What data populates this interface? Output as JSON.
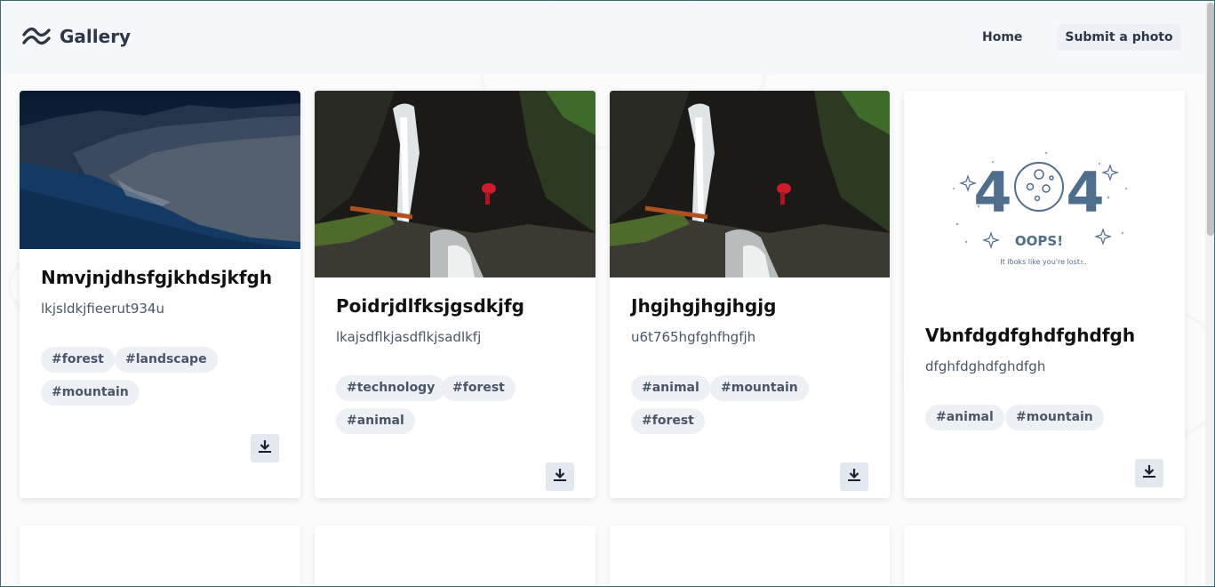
{
  "header": {
    "brand": "Gallery",
    "nav": {
      "home": "Home",
      "submit": "Submit a photo"
    }
  },
  "cards": [
    {
      "title": "Nmvjnjdhsfgjkhdsjkfgh",
      "description": "lkjsldkjfieerut934u",
      "tags": [
        "#forest",
        "#landscape",
        "#mountain"
      ],
      "image": "coastline-night-photo"
    },
    {
      "title": "Poidrjdlfksjgsdkjfg",
      "description": "lkajsdflkjasdflkjsadlkfj",
      "tags": [
        "#technology",
        "#forest",
        "#animal"
      ],
      "image": "waterfall-photo"
    },
    {
      "title": "Jhgjhgjhgjhgjg",
      "description": "u6t765hgfghfhgfjh",
      "tags": [
        "#animal",
        "#mountain",
        "#forest"
      ],
      "image": "waterfall-photo"
    },
    {
      "title": "Vbnfdgdfghdfghdfgh",
      "description": "dfghfdghdfghdfgh",
      "tags": [
        "#animal",
        "#mountain"
      ],
      "image": "404-placeholder",
      "placeholder": {
        "code_left": "4",
        "code_right": "4",
        "oops": "OOPS!",
        "lost": "It looks like you're lost..."
      }
    }
  ],
  "colors": {
    "accent": "#2d3748",
    "tag_bg": "#edf1f6",
    "button_bg": "#e3e8ef"
  }
}
